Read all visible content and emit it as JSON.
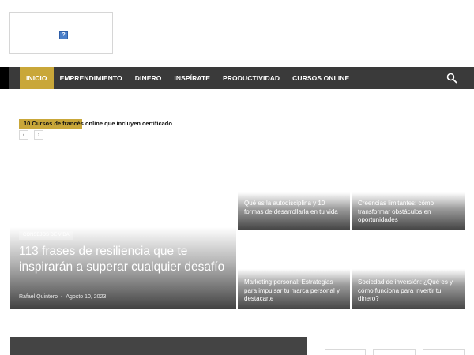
{
  "header": {
    "logo_icon": "broken-image-icon",
    "logo_glyph": "?"
  },
  "nav": {
    "items": [
      {
        "label": "INICIO",
        "active": true
      },
      {
        "label": "EMPRENDIMIENTO"
      },
      {
        "label": "DINERO"
      },
      {
        "label": "INSPÍRATE"
      },
      {
        "label": "PRODUCTIVIDAD"
      },
      {
        "label": "CURSOS ONLINE"
      }
    ],
    "search_icon": "search-icon"
  },
  "ticker": {
    "text": "10 Cursos de francés online que incluyen certificado",
    "prev": "‹",
    "next": "›"
  },
  "feature": {
    "category": "CONSEJOS DE VIDA",
    "title": "113 frases de resiliencia que te inspirarán a superar cualquier desafío",
    "author": "Rafael Quintero",
    "separator": "-",
    "date": "Agosto 10, 2023"
  },
  "cards": [
    {
      "title": "Qué es la autodisciplina y 10 formas de desarrollarla en tu vida"
    },
    {
      "title": "Creencias limitantes: cómo transformar obstáculos en oportunidades"
    },
    {
      "title": "Marketing personal: Estrategias para impulsar tu marca personal y destacarte"
    },
    {
      "title": "Sociedad de inversión: ¿Qué es y cómo funciona para invertir tu dinero?"
    }
  ],
  "colors": {
    "accent": "#c9a739",
    "nav_bg": "#3a3a3a"
  }
}
